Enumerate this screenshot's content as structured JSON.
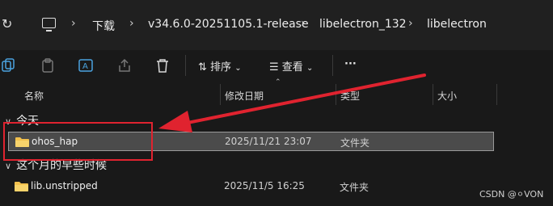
{
  "breadcrumb": {
    "items": [
      "下载",
      "v34.6.0-20251105.1-release",
      "libelectron_132",
      "libelectron"
    ]
  },
  "toolbar": {
    "sort_label": "排序",
    "view_label": "查看",
    "more_label": "···"
  },
  "columns": {
    "name": "名称",
    "modified": "修改日期",
    "type": "类型",
    "size": "大小"
  },
  "groups": [
    {
      "label": "今天",
      "rows": [
        {
          "name": "ohos_hap",
          "modified": "2025/11/21 23:07",
          "type": "文件夹",
          "selected": true
        }
      ]
    },
    {
      "label": "这个月的早些时候",
      "rows": [
        {
          "name": "lib.unstripped",
          "modified": "2025/11/5 16:25",
          "type": "文件夹",
          "selected": false
        }
      ]
    }
  ],
  "annotation": {
    "color": "#e0232f"
  },
  "watermark": "CSDN @⚪VON"
}
